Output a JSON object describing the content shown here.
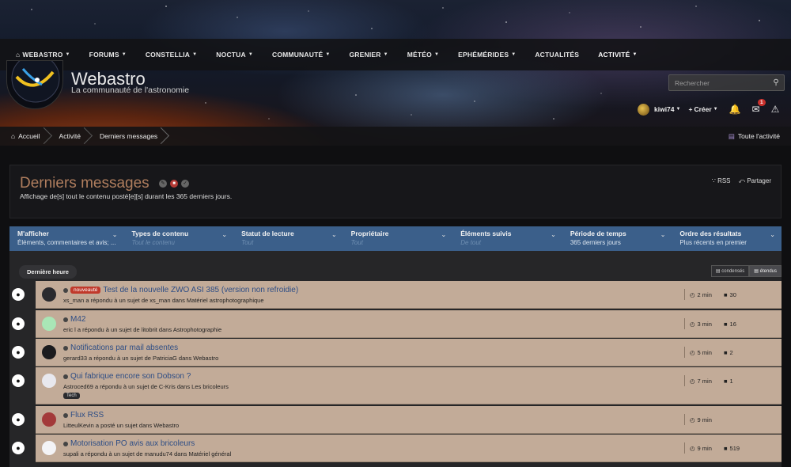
{
  "nav": {
    "items": [
      {
        "label": "WEBASTRO",
        "caret": true,
        "home": true
      },
      {
        "label": "FORUMS",
        "caret": true
      },
      {
        "label": "CONSTELLIA",
        "caret": true
      },
      {
        "label": "NOCTUA",
        "caret": true
      },
      {
        "label": "COMMUNAUTÉ",
        "caret": true
      },
      {
        "label": "GRENIER",
        "caret": true
      },
      {
        "label": "MÉTÉO",
        "caret": true
      },
      {
        "label": "EPHÉMÉRIDES",
        "caret": true
      },
      {
        "label": "ACTUALITÉS",
        "caret": false
      },
      {
        "label": "ACTIVITÉ",
        "caret": true,
        "active": true
      }
    ]
  },
  "site": {
    "title": "Webastro",
    "tagline": "La communauté de l'astronomie",
    "logo_text": "WWW.WEBASTRO.NET"
  },
  "search": {
    "placeholder": "Rechercher"
  },
  "user": {
    "name": "kiwi74",
    "create_label": "Créer",
    "messages_count": "1"
  },
  "breadcrumb": {
    "home": "Accueil",
    "activity": "Activité",
    "current": "Derniers messages",
    "all_activity": "Toute l'activité"
  },
  "page": {
    "title": "Derniers messages",
    "description": "Affichage de[s] tout le contenu posté[e][s] durant les 365 derniers jours.",
    "rss": "RSS",
    "share": "Partager"
  },
  "filters": [
    {
      "label": "M'afficher",
      "value": "Éléments, commentaires et avis; ...",
      "muted": false
    },
    {
      "label": "Types de contenu",
      "value": "Tout le contenu",
      "muted": true
    },
    {
      "label": "Statut de lecture",
      "value": "Tout",
      "muted": true
    },
    {
      "label": "Propriétaire",
      "value": "Tout",
      "muted": true
    },
    {
      "label": "Éléments suivis",
      "value": "De tout",
      "muted": true
    },
    {
      "label": "Période de temps",
      "value": "365 derniers jours",
      "muted": false
    },
    {
      "label": "Ordre des résultats",
      "value": "Plus récents en premier",
      "muted": false
    }
  ],
  "stream": {
    "block_label": "Dernière heure",
    "view_condensed": "condensés",
    "view_expanded": "étendus"
  },
  "rows": [
    {
      "new_label": "nouveauté",
      "title": "Test de la nouvelle ZWO ASI 385 (version non refroidie)",
      "sub": "xs_man a répondu à un sujet de xs_man dans Matériel astrophotographique",
      "time": "2 min",
      "replies": "30",
      "avatar": "#2a2a2e",
      "prefix": ""
    },
    {
      "new_label": "",
      "title": "M42",
      "sub": "eric l a répondu à un sujet de litobrit dans Astrophotographie",
      "time": "3 min",
      "replies": "16",
      "avatar": "#a9e6b6",
      "prefix": ""
    },
    {
      "new_label": "",
      "title": "Notifications par mail absentes",
      "sub": "gerard33 a répondu à un sujet de PatriciaG dans Webastro",
      "time": "5 min",
      "replies": "2",
      "avatar": "#1b1b1e",
      "prefix": ""
    },
    {
      "new_label": "",
      "title": "Qui fabrique encore son Dobson ?",
      "sub": "Astroced69 a répondu à un sujet de C-Kris dans Les bricoleurs",
      "time": "7 min",
      "replies": "1",
      "avatar": "#e8e8ee",
      "prefix": "Tech"
    },
    {
      "new_label": "",
      "title": "Flux RSS",
      "sub": "LitteulKevin a posté un sujet dans Webastro",
      "time": "9 min",
      "replies": "",
      "avatar": "#a33a3a",
      "prefix": ""
    },
    {
      "new_label": "",
      "title": "Motorisation PO avis aux bricoleurs",
      "sub": "supali a répondu à un sujet de manudu74 dans Matériel général",
      "time": "9 min",
      "replies": "519",
      "avatar": "#f3f3f6",
      "prefix": ""
    }
  ]
}
